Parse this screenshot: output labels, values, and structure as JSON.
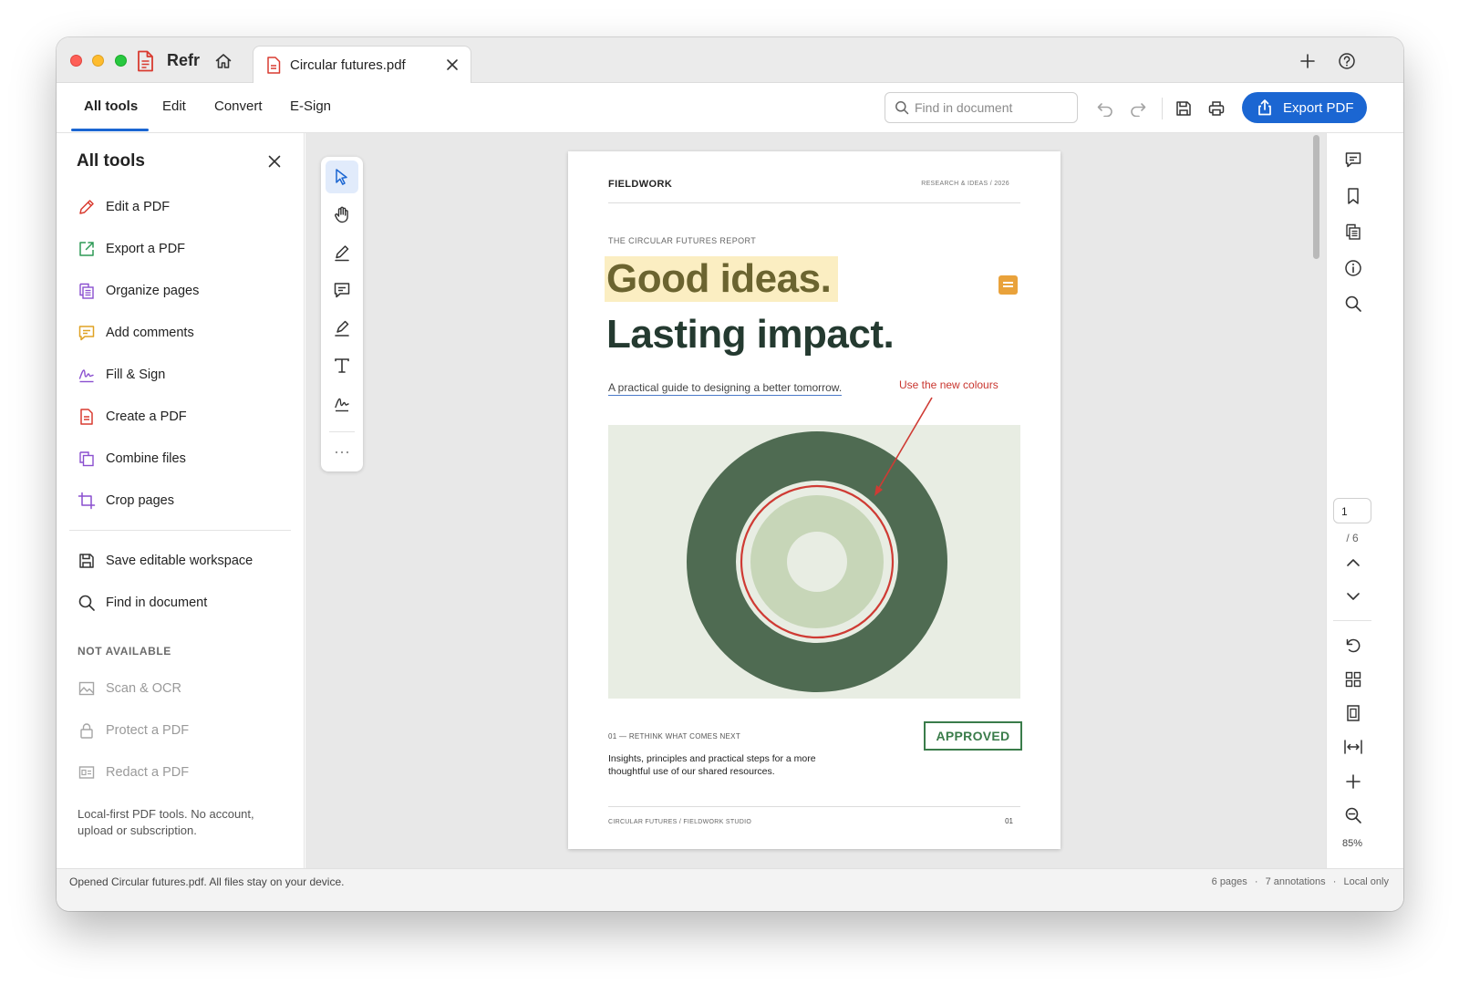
{
  "app": {
    "name": "Refr",
    "accent_color": "#1b66d2"
  },
  "tab": {
    "title": "Circular futures.pdf"
  },
  "toolbar": {
    "nav_tabs": [
      "All tools",
      "Edit",
      "Convert",
      "E-Sign"
    ],
    "active_tab": "All tools",
    "search_placeholder": "Find in document",
    "export_label": "Export PDF"
  },
  "left_panel": {
    "title": "All tools",
    "tools": [
      {
        "label": "Edit a PDF",
        "icon": "pencil-icon"
      },
      {
        "label": "Export a PDF",
        "icon": "export-icon"
      },
      {
        "label": "Organize pages",
        "icon": "pages-icon"
      },
      {
        "label": "Add comments",
        "icon": "comment-icon"
      },
      {
        "label": "Fill & Sign",
        "icon": "signature-icon"
      },
      {
        "label": "Create a PDF",
        "icon": "document-icon"
      },
      {
        "label": "Combine files",
        "icon": "combine-icon"
      },
      {
        "label": "Crop pages",
        "icon": "crop-icon"
      }
    ],
    "extra_tools": [
      {
        "label": "Save editable workspace",
        "icon": "save-icon"
      },
      {
        "label": "Find in document",
        "icon": "search-icon"
      }
    ],
    "not_available_label": "NOT AVAILABLE",
    "unavailable_tools": [
      {
        "label": "Scan & OCR",
        "icon": "image-icon"
      },
      {
        "label": "Protect a PDF",
        "icon": "lock-icon"
      },
      {
        "label": "Redact a PDF",
        "icon": "redact-icon"
      }
    ],
    "note": "Local-first PDF tools. No account, upload or subscription."
  },
  "document_page": {
    "brand": "FIELDWORK",
    "meta": "RESEARCH & IDEAS / 2026",
    "kicker": "THE CIRCULAR FUTURES REPORT",
    "headline_1": "Good ideas.",
    "headline_2": "Lasting impact.",
    "subtitle": "A practical guide to designing a better tomorrow.",
    "annotation": "Use the new colours",
    "section_label": "01 — RETHINK WHAT COMES NEXT",
    "body": "Insights, principles and practical steps for a more thoughtful use of our shared resources.",
    "stamp": "APPROVED",
    "footer_left": "CIRCULAR FUTURES / FIELDWORK STUDIO",
    "footer_right": "01"
  },
  "page_nav": {
    "current": "1",
    "total": "/ 6",
    "zoom": "85%"
  },
  "status": {
    "message": "Opened Circular futures.pdf. All files stay on your device.",
    "pages": "6 pages",
    "annotations": "7 annotations",
    "mode": "Local only",
    "separator": "·"
  }
}
